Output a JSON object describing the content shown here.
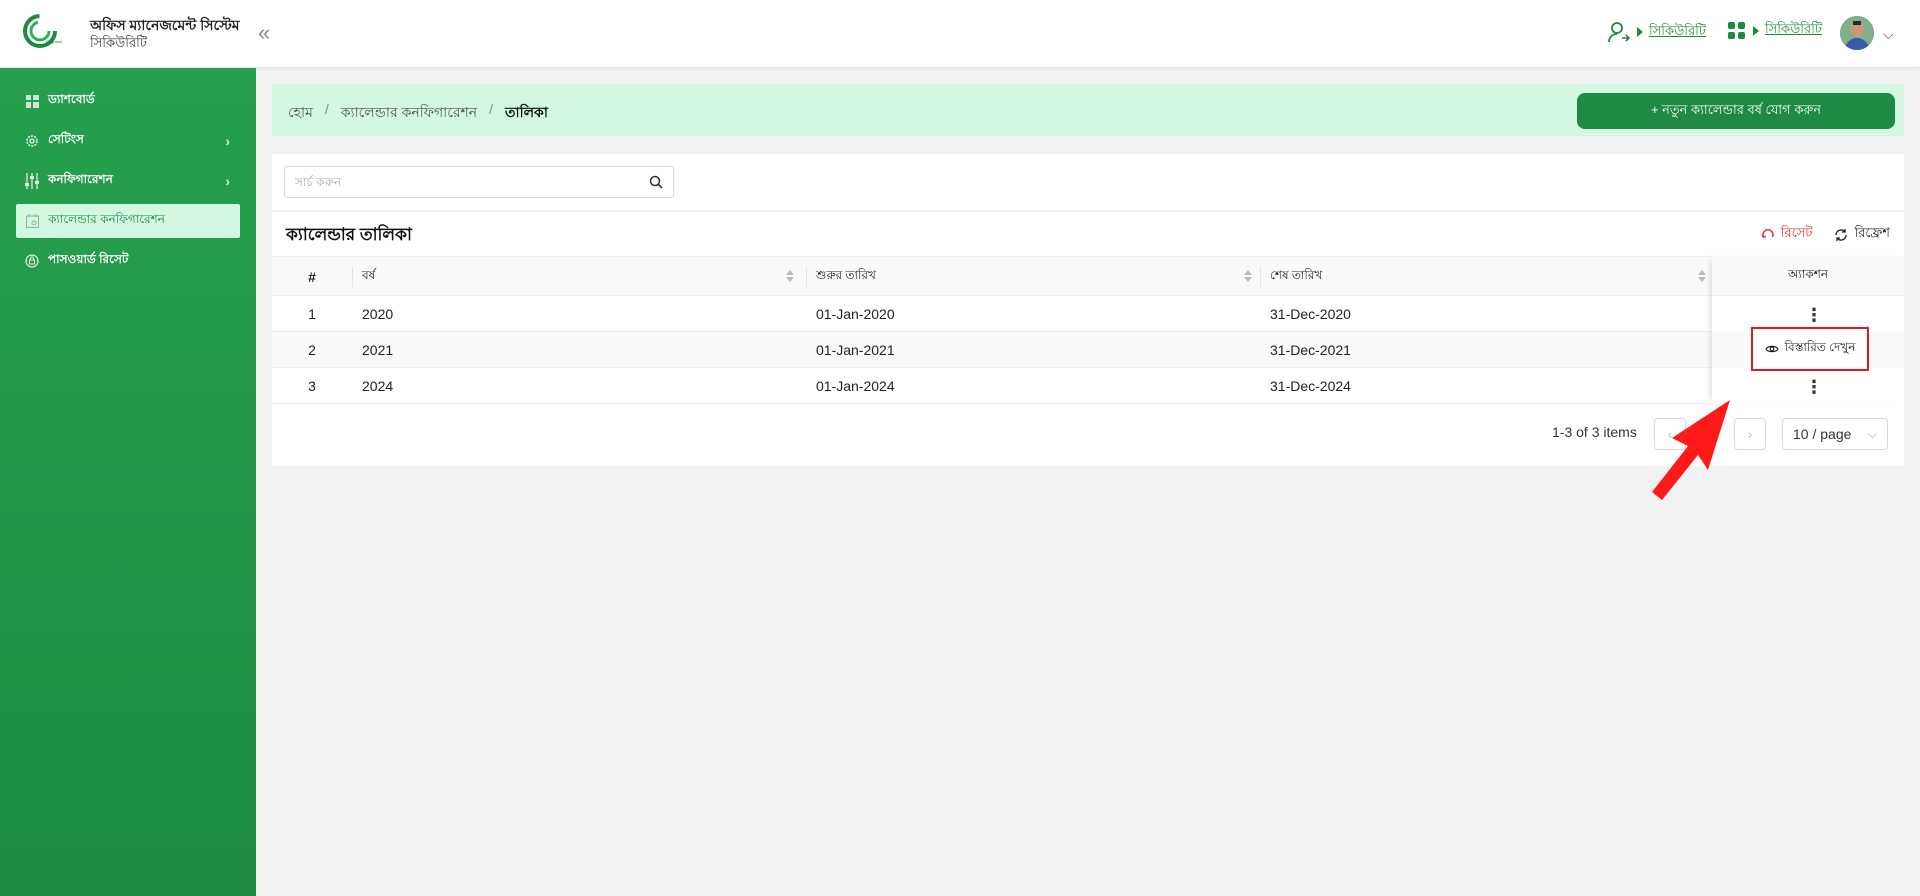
{
  "header": {
    "app_title": "অফিস ম্যানেজমেন্ট সিস্টেম",
    "app_subtitle": "সিকিউরিটি",
    "collapse_icon": "«",
    "role_link": "সিকিউরিটি",
    "module_link": "সিকিউরিটি"
  },
  "sidebar": {
    "items": [
      {
        "label": "ড্যাশবোর্ড",
        "icon": "dashboard-icon"
      },
      {
        "label": "সেটিংস",
        "icon": "gear-icon"
      },
      {
        "label": "কনফিগারেশন",
        "icon": "sliders-icon"
      },
      {
        "label": "ক্যালেন্ডার কনফিগারেশন",
        "icon": "calendar-icon"
      },
      {
        "label": "পাসওয়ার্ড রিসেট",
        "icon": "password-reset-icon"
      }
    ]
  },
  "breadcrumb": {
    "home": "হোম",
    "section": "ক্যালেন্ডার কনফিগারেশন",
    "current": "তালিকা",
    "separator": "/"
  },
  "add_button": "+ নতুন ক্যালেন্ডার বর্ষ যোগ করুন",
  "search": {
    "placeholder": "সার্চ করুন"
  },
  "table": {
    "title": "ক্যালেন্ডার তালিকা",
    "reset_label": "রিসেট",
    "refresh_label": "রিফ্রেশ",
    "columns": [
      "#",
      "বর্ষ",
      "শুরুর তারিখ",
      "শেষ তারিখ",
      "অ্যাকশন"
    ],
    "rows": [
      {
        "no": "1",
        "year": "2020",
        "start": "01-Jan-2020",
        "end": "31-Dec-2020"
      },
      {
        "no": "2",
        "year": "2021",
        "start": "01-Jan-2021",
        "end": "31-Dec-2021"
      },
      {
        "no": "3",
        "year": "2024",
        "start": "01-Jan-2024",
        "end": "31-Dec-2024"
      }
    ],
    "action_menu_item": "বিস্তারিত দেখুন"
  },
  "pagination": {
    "summary": "1-3 of 3 items",
    "page_size": "10 / page"
  },
  "colors": {
    "brand": "#1f8a44",
    "sidebar_top": "#26a04c",
    "sidebar_bottom": "#1d8c3f",
    "breadcrumb_bg": "#d3f7e0",
    "reset": "#e0353b",
    "annotation": "#ff1a1a"
  }
}
